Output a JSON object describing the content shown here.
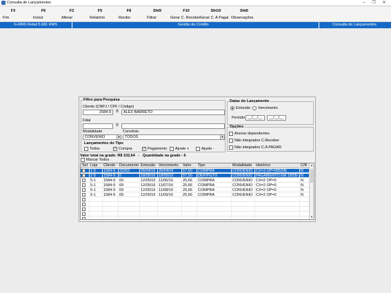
{
  "window": {
    "title": "Consulta de Lançamentos"
  },
  "toolbar": [
    {
      "key": "F3",
      "label": "Fim"
    },
    {
      "key": "F6",
      "label": "Incluir"
    },
    {
      "key": "F2",
      "label": "Alterar"
    },
    {
      "key": "F5",
      "label": "Relatório"
    },
    {
      "key": "F8",
      "label": "Recibo"
    },
    {
      "key": "Sht9",
      "label": "Filtrar"
    },
    {
      "key": "F10",
      "label": "Gerar C. Receber"
    },
    {
      "key": "Sht10",
      "label": "Gerar C. A Pagar"
    },
    {
      "key": "Sht6",
      "label": "Observações"
    }
  ],
  "infobar": {
    "left": "G-RMS Retail 5.681 RMS",
    "center": "Gestão de Crédito",
    "right": "Consulta de Lançamentos",
    "color": "#1569c7"
  },
  "filter": {
    "title": "Filtro para Pesquisa",
    "client_label": "Cliente (CNPJ / CPF / Código)",
    "client_code": "1584-9",
    "client_name": "ALEX BARRETO",
    "filial_label": "Filial",
    "filial_code": "",
    "filial_name": "",
    "modalidade_label": "Modalidade",
    "modalidade_value": "CONVENIO",
    "convenio_label": "Convênio",
    "convenio_value": "TODOS",
    "tipo_title": "Lançamentos do Tipo",
    "tipo_options": [
      {
        "label": "Todos",
        "checked": false
      },
      {
        "label": "Compra",
        "checked": true
      },
      {
        "label": "Pagamento",
        "checked": true
      },
      {
        "label": "Ajuste +",
        "checked": false
      },
      {
        "label": "Ajuste -",
        "checked": false
      }
    ]
  },
  "datas": {
    "title": "Datas do Lançamento",
    "emissao_label": "Emissão",
    "vencimento_label": "Vencimento",
    "periodo_label": "Período",
    "date_start": "__/__/__",
    "date_end": "__/__/__"
  },
  "opcoes": {
    "title": "Opções",
    "items": [
      "Anexar dependentes",
      "Não integrados C.Receber",
      "Não integrados C.A PAGAR"
    ]
  },
  "totals": {
    "valor_label": "Valor total na grade:",
    "valor": "R$ 102,64",
    "qtd_label": "Quantidade na grade :",
    "qtd": "6",
    "separator": "-"
  },
  "marcar_todos": "Marcar Todos",
  "table": {
    "columns": [
      "Sel",
      "Loja",
      "Cliente",
      "Documento",
      "Emissão",
      "Vencimento",
      "Valor",
      "Tipo",
      "Modalidade",
      "Histórico",
      "C/R"
    ],
    "rows": [
      {
        "sel": true,
        "loja": "1-5",
        "cliente": "1584-9",
        "doc": "22262",
        "emissao": "26/04/16",
        "venc": "26/04/16",
        "valor": "57,50",
        "tipo": "COMPRA",
        "mod": "CONVENIO",
        "hist": "CX=3 OP=095336",
        "cr": "N",
        "highlight": true
      },
      {
        "sel": true,
        "loja": "1-5",
        "cliente": "1584-9",
        "doc": "0",
        "emissao": "18/05/16",
        "venc": "18/05/16",
        "valor": "57,50",
        "tipo": "DEP/PGTO",
        "mod": "CONVENIO",
        "hist": "PAGAMENTO EM 18/05/",
        "cr": "N",
        "highlight": true
      },
      {
        "sel": false,
        "loja": "5-1",
        "cliente": "1584-9",
        "doc": "69",
        "emissao": "12/05/16",
        "venc": "11/06/16",
        "valor": "25,66",
        "tipo": "COMPRA",
        "mod": "CONVENIO",
        "hist": "CX=2 OP=0",
        "cr": "N",
        "highlight": false
      },
      {
        "sel": false,
        "loja": "5-1",
        "cliente": "1584-9",
        "doc": "69",
        "emissao": "12/05/16",
        "venc": "11/07/16",
        "valor": "25,66",
        "tipo": "COMPRA",
        "mod": "CONVENIO",
        "hist": "CX=2 OP=0",
        "cr": "N",
        "highlight": false
      },
      {
        "sel": false,
        "loja": "5-1",
        "cliente": "1584-9",
        "doc": "69",
        "emissao": "12/05/16",
        "venc": "11/08/16",
        "valor": "25,66",
        "tipo": "COMPRA",
        "mod": "CONVENIO",
        "hist": "CX=2 OP=0",
        "cr": "N",
        "highlight": false
      },
      {
        "sel": false,
        "loja": "5-1",
        "cliente": "1584-9",
        "doc": "69",
        "emissao": "12/05/16",
        "venc": "11/09/16",
        "valor": "25,66",
        "tipo": "COMPRA",
        "mod": "CONVENIO",
        "hist": "CX=2 OP=0",
        "cr": "N",
        "highlight": false
      }
    ],
    "empty_rows": 5
  },
  "colors": {
    "selected_row": "#1569c7"
  },
  "icons": {
    "search": "binoculars-icon"
  }
}
